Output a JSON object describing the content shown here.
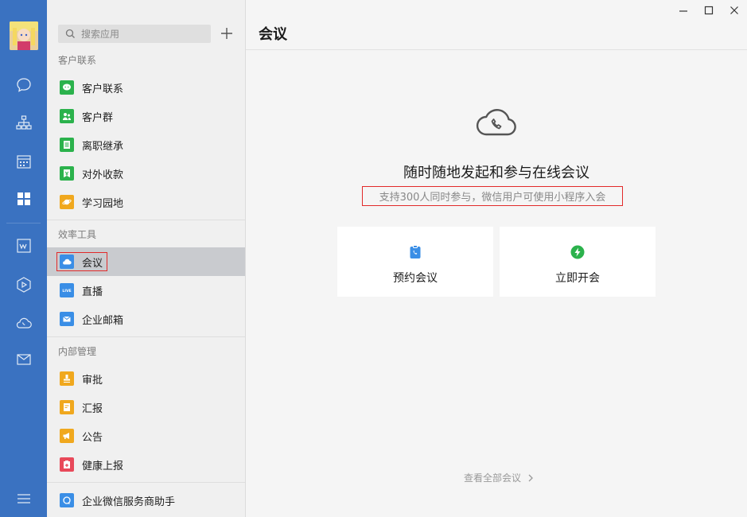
{
  "rail": {
    "icons": [
      "chat-icon",
      "org-chart-icon",
      "calendar-icon",
      "apps-icon",
      "document-icon",
      "drive-icon",
      "meeting-icon",
      "mail-icon",
      "menu-icon"
    ]
  },
  "panel": {
    "search_placeholder": "搜索应用",
    "groups": [
      {
        "title": "客户联系"
      },
      {
        "title": "效率工具"
      },
      {
        "title": "内部管理"
      }
    ],
    "items": [
      {
        "label": "客户联系",
        "icon": "wechat-icon",
        "color": "#2bb24c"
      },
      {
        "label": "客户群",
        "icon": "group-icon",
        "color": "#2bb24c"
      },
      {
        "label": "离职继承",
        "icon": "doc-icon",
        "color": "#2bb24c"
      },
      {
        "label": "对外收款",
        "icon": "payment-icon",
        "color": "#2bb24c"
      },
      {
        "label": "学习园地",
        "icon": "planet-icon",
        "color": "#f0a81e"
      },
      {
        "label": "会议",
        "icon": "meeting-icon",
        "color": "#3a8ee6"
      },
      {
        "label": "直播",
        "icon": "live-icon",
        "color": "#3a8ee6"
      },
      {
        "label": "企业邮箱",
        "icon": "mail-icon",
        "color": "#3a8ee6"
      },
      {
        "label": "审批",
        "icon": "stamp-icon",
        "color": "#f0a81e"
      },
      {
        "label": "汇报",
        "icon": "report-icon",
        "color": "#f0a81e"
      },
      {
        "label": "公告",
        "icon": "megaphone-icon",
        "color": "#f0a81e"
      },
      {
        "label": "健康上报",
        "icon": "health-icon",
        "color": "#e8495a"
      },
      {
        "label": "企业微信服务商助手",
        "icon": "assistant-icon",
        "color": "#3a8ee6"
      }
    ]
  },
  "main": {
    "title": "会议",
    "headline": "随时随地发起和参与在线会议",
    "subline": "支持300人同时参与，微信用户可使用小程序入会",
    "cards": [
      {
        "label": "预约会议",
        "icon": "schedule-icon",
        "color": "#3a8ee6"
      },
      {
        "label": "立即开会",
        "icon": "bolt-icon",
        "color": "#2bb24c"
      }
    ],
    "view_all": "查看全部会议"
  }
}
